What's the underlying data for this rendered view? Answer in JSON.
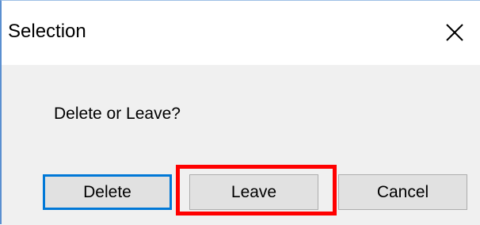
{
  "window": {
    "title": "Selection",
    "close_icon": "close-icon"
  },
  "dialog": {
    "message": "Delete or Leave?"
  },
  "buttons": {
    "delete_label": "Delete",
    "leave_label": "Leave",
    "cancel_label": "Cancel"
  },
  "annotation": {
    "highlight_color": "#ff0000",
    "highlighted_target": "leave-button"
  },
  "colors": {
    "focus_border": "#0078d7",
    "dialog_background": "#f0f0f0",
    "titlebar_background": "#ffffff",
    "button_face": "#e1e1e1"
  }
}
